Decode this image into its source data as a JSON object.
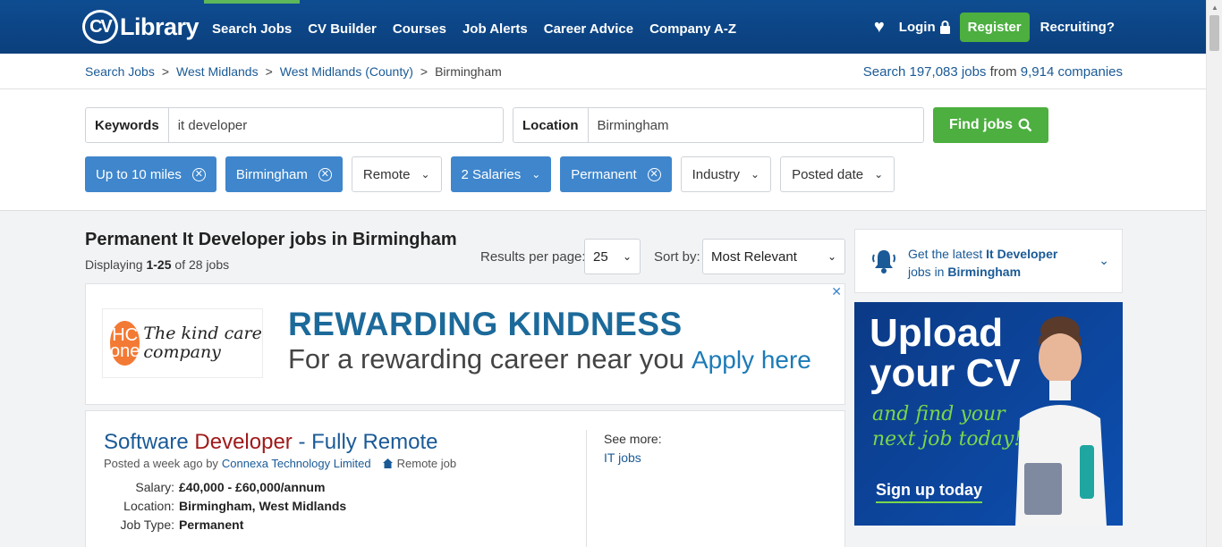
{
  "header": {
    "logo_cv": "CV",
    "logo_text": "Library",
    "nav": [
      "Search Jobs",
      "CV Builder",
      "Courses",
      "Job Alerts",
      "Career Advice",
      "Company A-Z"
    ],
    "login": "Login",
    "register": "Register",
    "recruiting": "Recruiting?"
  },
  "breadcrumb": {
    "items": [
      "Search Jobs",
      "West Midlands",
      "West Midlands (County)",
      "Birmingham"
    ],
    "sep": ">",
    "count_prefix": "Search",
    "count_jobs": "197,083 jobs",
    "count_mid": "from",
    "count_companies": "9,914 companies"
  },
  "search": {
    "keywords_label": "Keywords",
    "keywords_value": "it developer",
    "location_label": "Location",
    "location_value": "Birmingham",
    "find_label": "Find jobs"
  },
  "filters": [
    {
      "label": "Up to 10 miles",
      "active": true
    },
    {
      "label": "Birmingham",
      "active": true
    },
    {
      "label": "Remote",
      "active": false
    },
    {
      "label": "2 Salaries",
      "active": true
    },
    {
      "label": "Permanent",
      "active": true
    },
    {
      "label": "Industry",
      "active": false
    },
    {
      "label": "Posted date",
      "active": false
    }
  ],
  "results": {
    "heading": "Permanent It Developer jobs in Birmingham",
    "displaying_prefix": "Displaying",
    "displaying_range": "1-25",
    "displaying_suffix": "of 28 jobs",
    "rpp_label": "Results per page:",
    "rpp_value": "25",
    "sort_label": "Sort by:",
    "sort_value": "Most Relevant"
  },
  "ad": {
    "logo_initials": "HC one",
    "logo_text": "The kind care company",
    "headline": "REWARDING KINDNESS",
    "subline": "For a rewarding career near you",
    "cta": "Apply here",
    "close": "✕"
  },
  "job": {
    "title_a": "Software ",
    "title_hl": "Developer",
    "title_b": " - Fully Remote",
    "posted": "Posted a week ago by",
    "company": "Connexa Technology Limited",
    "remote": "Remote job",
    "salary_label": "Salary:",
    "salary": "£40,000 - £60,000/annum",
    "location_label": "Location:",
    "location": "Birmingham, West Midlands",
    "type_label": "Job Type:",
    "type": "Permanent",
    "see_more": "See more:",
    "see_more_link": "IT jobs"
  },
  "alert": {
    "prefix": "Get the latest",
    "keyword": "It Developer",
    "mid": "jobs in",
    "place": "Birmingham"
  },
  "banner": {
    "line1": "Upload",
    "line2": "your CV",
    "line3": "and find your",
    "line4": "next job today!",
    "cta": "Sign up today"
  },
  "colors": {
    "brand_blue": "#0e4c91",
    "green": "#4caf3f",
    "chip_blue": "#3f86cc",
    "link": "#1a5a96",
    "highlight_red": "#a01a1a"
  }
}
